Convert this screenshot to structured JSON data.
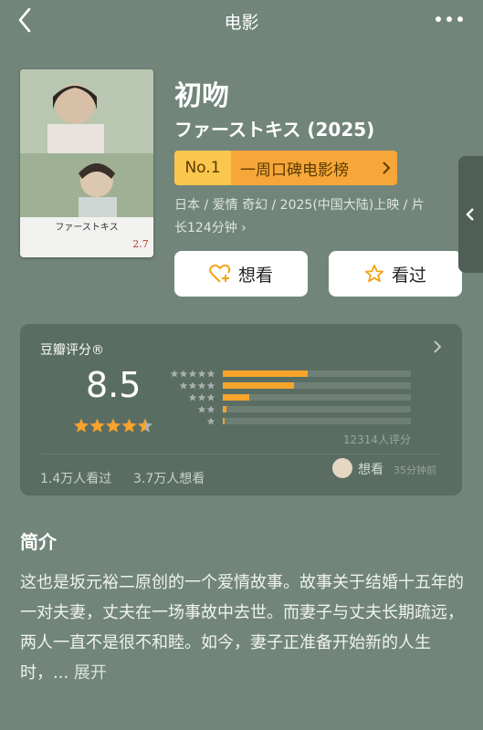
{
  "nav": {
    "title": "电影"
  },
  "movie": {
    "title": "初吻",
    "original_title": "ファーストキス (2025)",
    "ranking": {
      "number": "No.1",
      "name": "一周口碑电影榜"
    },
    "meta_line1": "日本 / 爱情 奇幻 / 2025(中国大陆)上映 / 片",
    "meta_line2": "长124分钟 ›",
    "poster": {
      "tagline": "ファーストキス",
      "date": "2.7"
    }
  },
  "actions": {
    "want_label": "想看",
    "seen_label": "看过"
  },
  "rating": {
    "title": "豆瓣评分®",
    "score": "8.5",
    "stars": 4.5,
    "distribution": [
      0.45,
      0.38,
      0.14,
      0.02,
      0.01
    ],
    "count_text": "12314人评分",
    "watched_text": "1.4万人看过",
    "want_text": "3.7万人想看",
    "friend_action": "想看",
    "friend_time": "35分钟前"
  },
  "intro": {
    "title": "简介",
    "text": "这也是坂元裕二原创的一个爱情故事。故事关于结婚十五年的一对夫妻，丈夫在一场事故中去世。而妻子与丈夫长期疏远，两人一直不是很不和睦。如今，妻子正准备开始新的人生时，...",
    "expand": "展开"
  },
  "colors": {
    "background": "#71857b",
    "accent": "#f7a32c",
    "card": "#5a6d63"
  }
}
